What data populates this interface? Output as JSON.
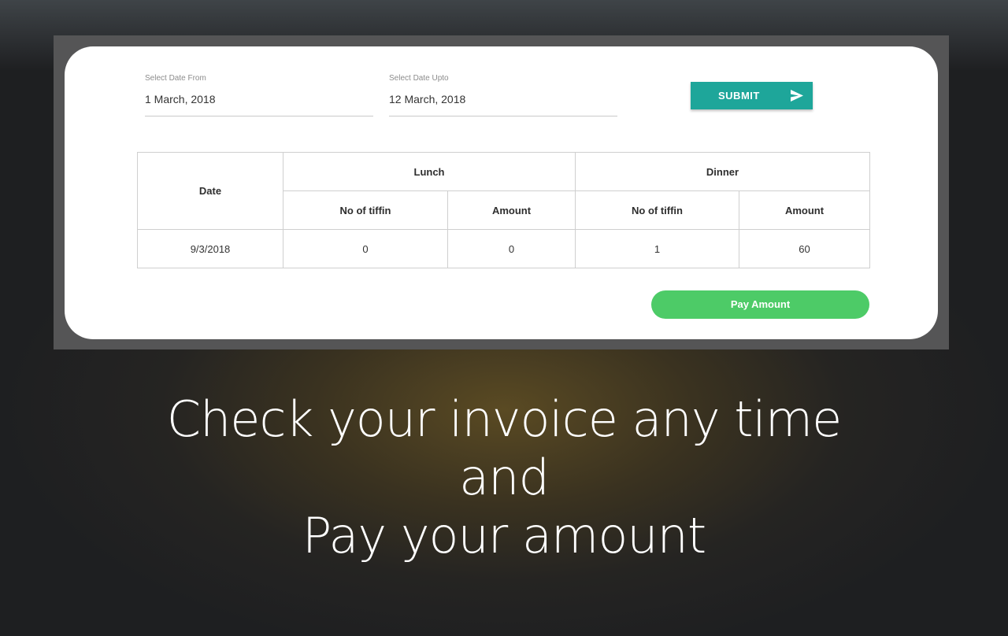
{
  "filters": {
    "from_label": "Select Date From",
    "from_value": "1 March, 2018",
    "upto_label": "Select Date Upto",
    "upto_value": "12 March, 2018",
    "submit_label": "SUBMIT",
    "submit_icon": "send-arrow-icon"
  },
  "table": {
    "col_date": "Date",
    "group_lunch": "Lunch",
    "group_dinner": "Dinner",
    "sub_tiffin": "No of tiffin",
    "sub_amount": "Amount",
    "rows": [
      {
        "date": "9/3/2018",
        "lunch_tiffin": "0",
        "lunch_amount": "0",
        "dinner_tiffin": "1",
        "dinner_amount": "60"
      }
    ]
  },
  "pay_button": {
    "label": "Pay Amount"
  },
  "caption": {
    "line1": "Check your invoice any time",
    "line2": "and",
    "line3": "Pay your amount"
  },
  "colors": {
    "submit": "#1ea69a",
    "pay": "#4dcb67",
    "card": "#ffffff",
    "frame": "#555556"
  }
}
